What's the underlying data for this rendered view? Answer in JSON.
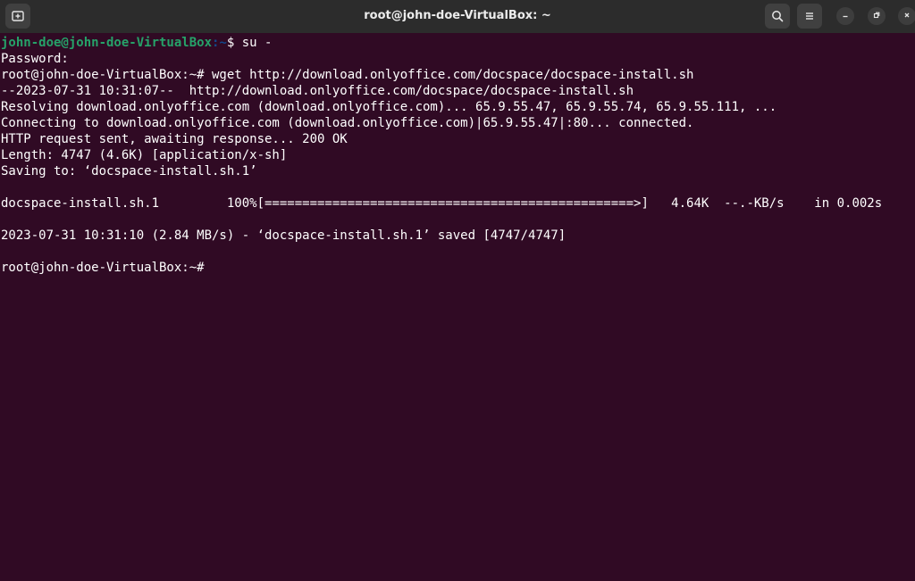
{
  "window": {
    "title": "root@john-doe-VirtualBox: ~"
  },
  "colors": {
    "terminal_bg": "#300a24",
    "titlebar_bg": "#2c2c2c",
    "prompt_user": "#26a269",
    "prompt_path": "#12488b",
    "text": "#ffffff"
  },
  "toolbar": {
    "new_tab_icon": "new-tab-icon",
    "search_icon": "search-icon",
    "menu_icon": "hamburger-menu-icon",
    "minimize_icon": "minimize-icon",
    "maximize_icon": "restore-icon",
    "close_icon": "close-icon"
  },
  "terminal": {
    "first_prompt": {
      "user_host": "john-doe@john-doe-VirtualBox",
      "path": ":~",
      "symbol": "$ ",
      "command": "su -"
    },
    "lines": [
      "Password:",
      "root@john-doe-VirtualBox:~# wget http://download.onlyoffice.com/docspace/docspace-install.sh",
      "--2023-07-31 10:31:07--  http://download.onlyoffice.com/docspace/docspace-install.sh",
      "Resolving download.onlyoffice.com (download.onlyoffice.com)... 65.9.55.47, 65.9.55.74, 65.9.55.111, ...",
      "Connecting to download.onlyoffice.com (download.onlyoffice.com)|65.9.55.47|:80... connected.",
      "HTTP request sent, awaiting response... 200 OK",
      "Length: 4747 (4.6K) [application/x-sh]",
      "Saving to: ‘docspace-install.sh.1’",
      "",
      "docspace-install.sh.1         100%[=================================================>]   4.64K  --.-KB/s    in 0.002s",
      "",
      "2023-07-31 10:31:10 (2.84 MB/s) - ‘docspace-install.sh.1’ saved [4747/4747]",
      "",
      "root@john-doe-VirtualBox:~#"
    ]
  }
}
